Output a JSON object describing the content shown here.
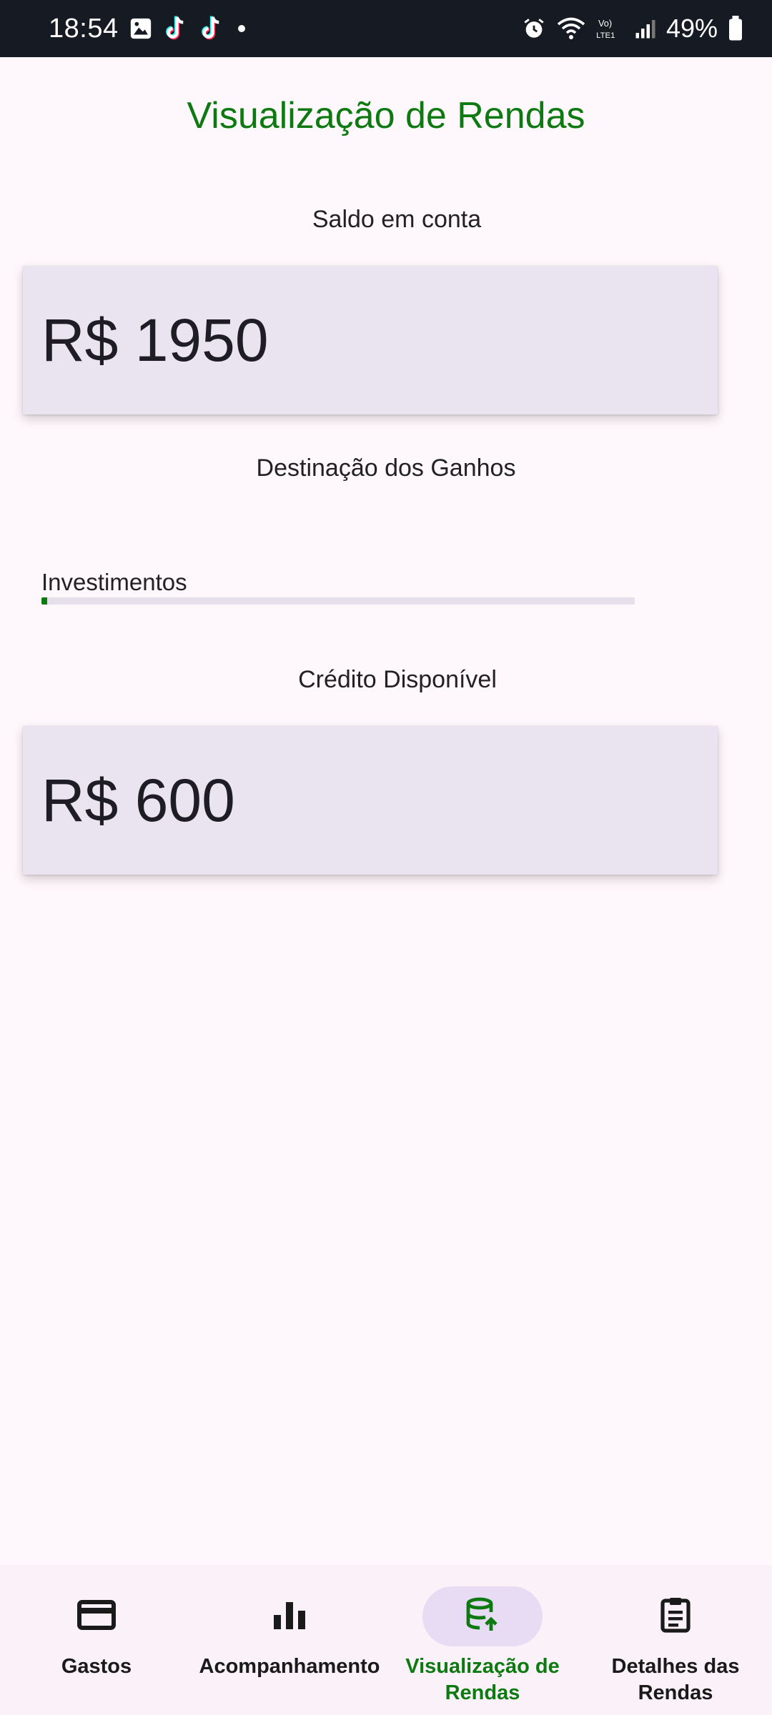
{
  "status_bar": {
    "time": "18:54",
    "battery_percent": "49%",
    "notification_icons": [
      "gallery-icon",
      "tiktok-icon",
      "tiktok-icon",
      "dot-icon"
    ],
    "system_icons": [
      "alarm-icon",
      "wifi-icon",
      "volte-icon",
      "signal-icon",
      "battery-icon"
    ],
    "network_label": "Vo) LTE1"
  },
  "page": {
    "title": "Visualização de Rendas"
  },
  "balance": {
    "label": "Saldo em conta",
    "value": "R$ 1950"
  },
  "earnings": {
    "label": "Destinação dos Ganhos",
    "items": [
      {
        "label": "Investimentos",
        "progress_fraction": 0.01
      }
    ]
  },
  "credit": {
    "label": "Crédito Disponível",
    "value": "R$ 600"
  },
  "bottom_nav": {
    "active_index": 2,
    "items": [
      {
        "label": "Gastos",
        "icon": "credit-card-icon"
      },
      {
        "label": "Acompanhamento",
        "icon": "bar-chart-icon"
      },
      {
        "label": "Visualização de Rendas",
        "icon": "database-upload-icon"
      },
      {
        "label": "Detalhes das Rendas",
        "icon": "clipboard-icon"
      }
    ]
  },
  "colors": {
    "accent": "#0c7a10",
    "card_background": "#e9e4f0",
    "page_background": "#fef7fb",
    "status_bar": "#161a22",
    "active_nav_pill": "#e7dcf3"
  }
}
